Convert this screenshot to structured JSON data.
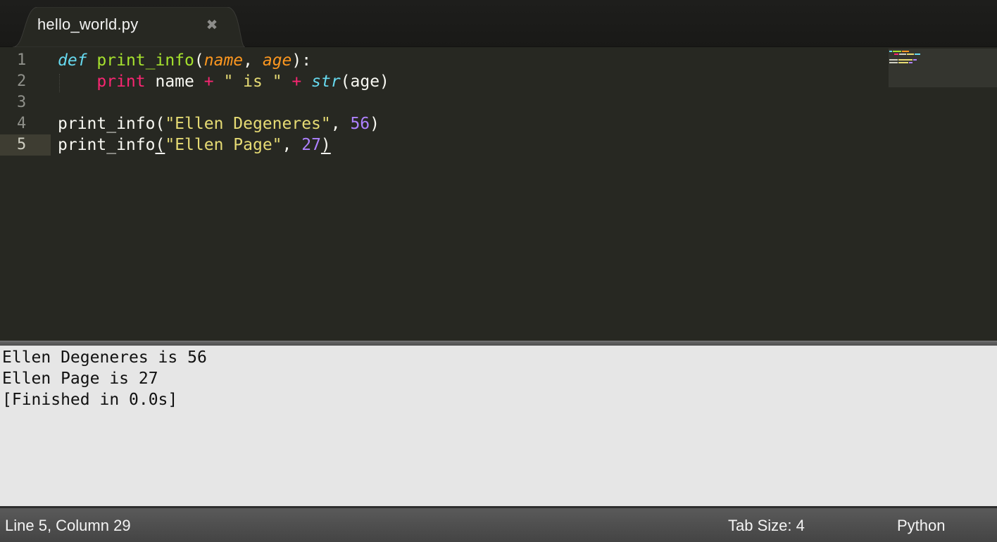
{
  "tab": {
    "filename": "hello_world.py",
    "close_glyph": "✖"
  },
  "editor": {
    "line_numbers": [
      "1",
      "2",
      "3",
      "4",
      "5"
    ],
    "active_line": 5,
    "lines": [
      [
        {
          "t": "def",
          "c": "kw-def"
        },
        {
          "t": " ",
          "c": ""
        },
        {
          "t": "print_info",
          "c": "fn"
        },
        {
          "t": "(",
          "c": ""
        },
        {
          "t": "name",
          "c": "param"
        },
        {
          "t": ", ",
          "c": ""
        },
        {
          "t": "age",
          "c": "param"
        },
        {
          "t": "):",
          "c": ""
        }
      ],
      [
        {
          "t": "    ",
          "c": ""
        },
        {
          "t": "print",
          "c": "kw"
        },
        {
          "t": " name ",
          "c": ""
        },
        {
          "t": "+",
          "c": "op"
        },
        {
          "t": " ",
          "c": ""
        },
        {
          "t": "\" is \"",
          "c": "str"
        },
        {
          "t": " ",
          "c": ""
        },
        {
          "t": "+",
          "c": "op"
        },
        {
          "t": " ",
          "c": ""
        },
        {
          "t": "str",
          "c": "builtin"
        },
        {
          "t": "(age)",
          "c": ""
        }
      ],
      [],
      [
        {
          "t": "print_info(",
          "c": ""
        },
        {
          "t": "\"Ellen Degeneres\"",
          "c": "str"
        },
        {
          "t": ", ",
          "c": ""
        },
        {
          "t": "56",
          "c": "num"
        },
        {
          "t": ")",
          "c": ""
        }
      ],
      [
        {
          "t": "print_info",
          "c": ""
        },
        {
          "t": "(",
          "c": "bracket-match"
        },
        {
          "t": "\"Ellen Page\"",
          "c": "str"
        },
        {
          "t": ", ",
          "c": ""
        },
        {
          "t": "27",
          "c": "num"
        },
        {
          "t": ")",
          "c": "bracket-match"
        }
      ]
    ]
  },
  "output": {
    "lines": [
      "Ellen Degeneres is 56",
      "Ellen Page is 27",
      "[Finished in 0.0s]"
    ]
  },
  "status": {
    "position": "Line 5, Column 29",
    "tab_size": "Tab Size: 4",
    "syntax": "Python"
  },
  "colors": {
    "editor_bg": "#272822",
    "keyword": "#f92672",
    "function": "#a6e22e",
    "string": "#e6db74",
    "number": "#ae81ff",
    "storage": "#66d9ef",
    "parameter": "#fd971f",
    "output_bg": "#e6e6e6"
  }
}
